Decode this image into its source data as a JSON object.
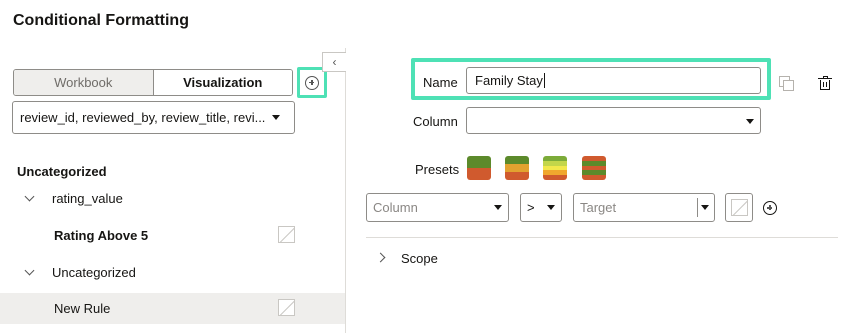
{
  "title": "Conditional Formatting",
  "left": {
    "tabs": [
      {
        "label": "Workbook",
        "active": false
      },
      {
        "label": "Visualization",
        "active": true
      }
    ],
    "add_icon": "circle-plus-icon",
    "collapse_icon": "chevron-left-icon",
    "columns_select": "review_id, reviewed_by, review_title, revi...",
    "tree": [
      {
        "label": "Uncategorized",
        "type": "header"
      },
      {
        "label": "rating_value",
        "type": "group"
      },
      {
        "label": "Rating Above 5",
        "type": "rule"
      },
      {
        "label": "Uncategorized",
        "type": "group"
      },
      {
        "label": "New Rule",
        "type": "rule",
        "selected": true
      }
    ]
  },
  "right": {
    "name_label": "Name",
    "name_value": "Family Stay",
    "column_label": "Column",
    "column_value": "",
    "presets_label": "Presets",
    "presets": [
      {
        "colors": [
          "#5c8a2b",
          "#d05a2e"
        ]
      },
      {
        "colors": [
          "#5c8a2b",
          "#e2a230",
          "#d05a2e"
        ]
      },
      {
        "colors": [
          "#7cab39",
          "#c3d64a",
          "#f2e84b",
          "#f0a72e",
          "#d05a2e"
        ]
      },
      {
        "colors": [
          "#d05a2e",
          "#5c8a2b",
          "#d05a2e",
          "#5c8a2b",
          "#d05a2e"
        ]
      }
    ],
    "condition": {
      "column_placeholder": "Column",
      "operator": ">",
      "target_placeholder": "Target"
    },
    "scope_label": "Scope",
    "accent_color": "#4ee1b5"
  }
}
